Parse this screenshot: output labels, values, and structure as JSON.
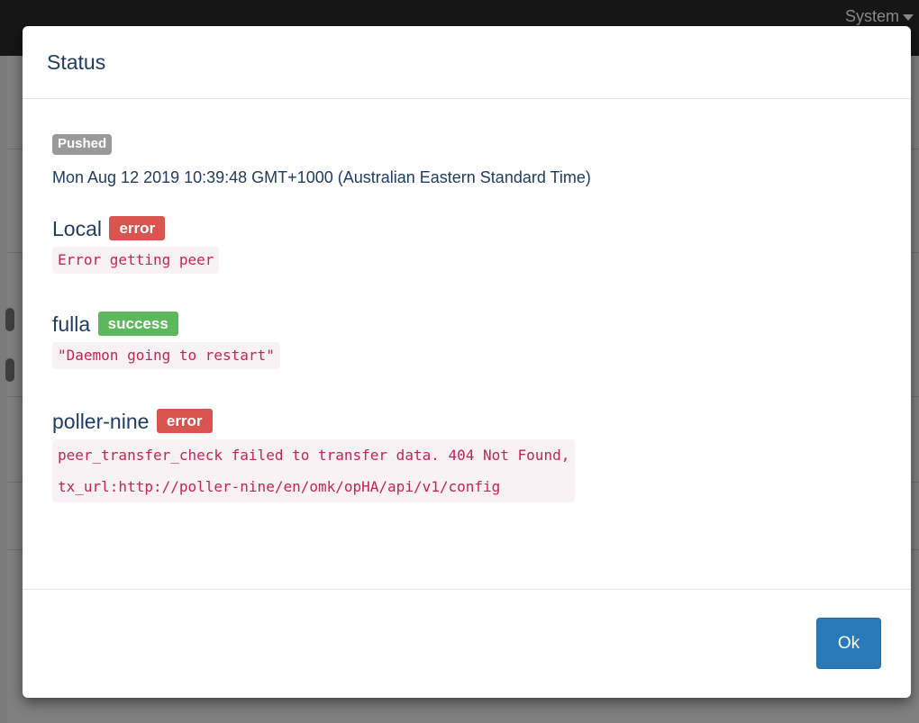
{
  "background": {
    "menu_system_label": "System"
  },
  "modal": {
    "title": "Status",
    "pushed_label": "Pushed",
    "pushed_time": "Mon Aug 12 2019 10:39:48 GMT+1000 (Australian Eastern Standard Time)",
    "peers": [
      {
        "name": "Local",
        "status": "error",
        "message": "Error getting peer"
      },
      {
        "name": "fulla",
        "status": "success",
        "message": "\"Daemon going to restart\""
      },
      {
        "name": "poller-nine",
        "status": "error",
        "message_line1": "peer_transfer_check failed to transfer data. 404 Not Found,",
        "message_line2": "tx_url:http://poller-nine/en/omk/opHA/api/v1/config"
      }
    ],
    "ok_label": "Ok"
  },
  "colors": {
    "error": "#d9534f",
    "success": "#5cb85c",
    "primary": "#2a7ab9",
    "text": "#1f3d63",
    "code_text": "#c7254e"
  }
}
